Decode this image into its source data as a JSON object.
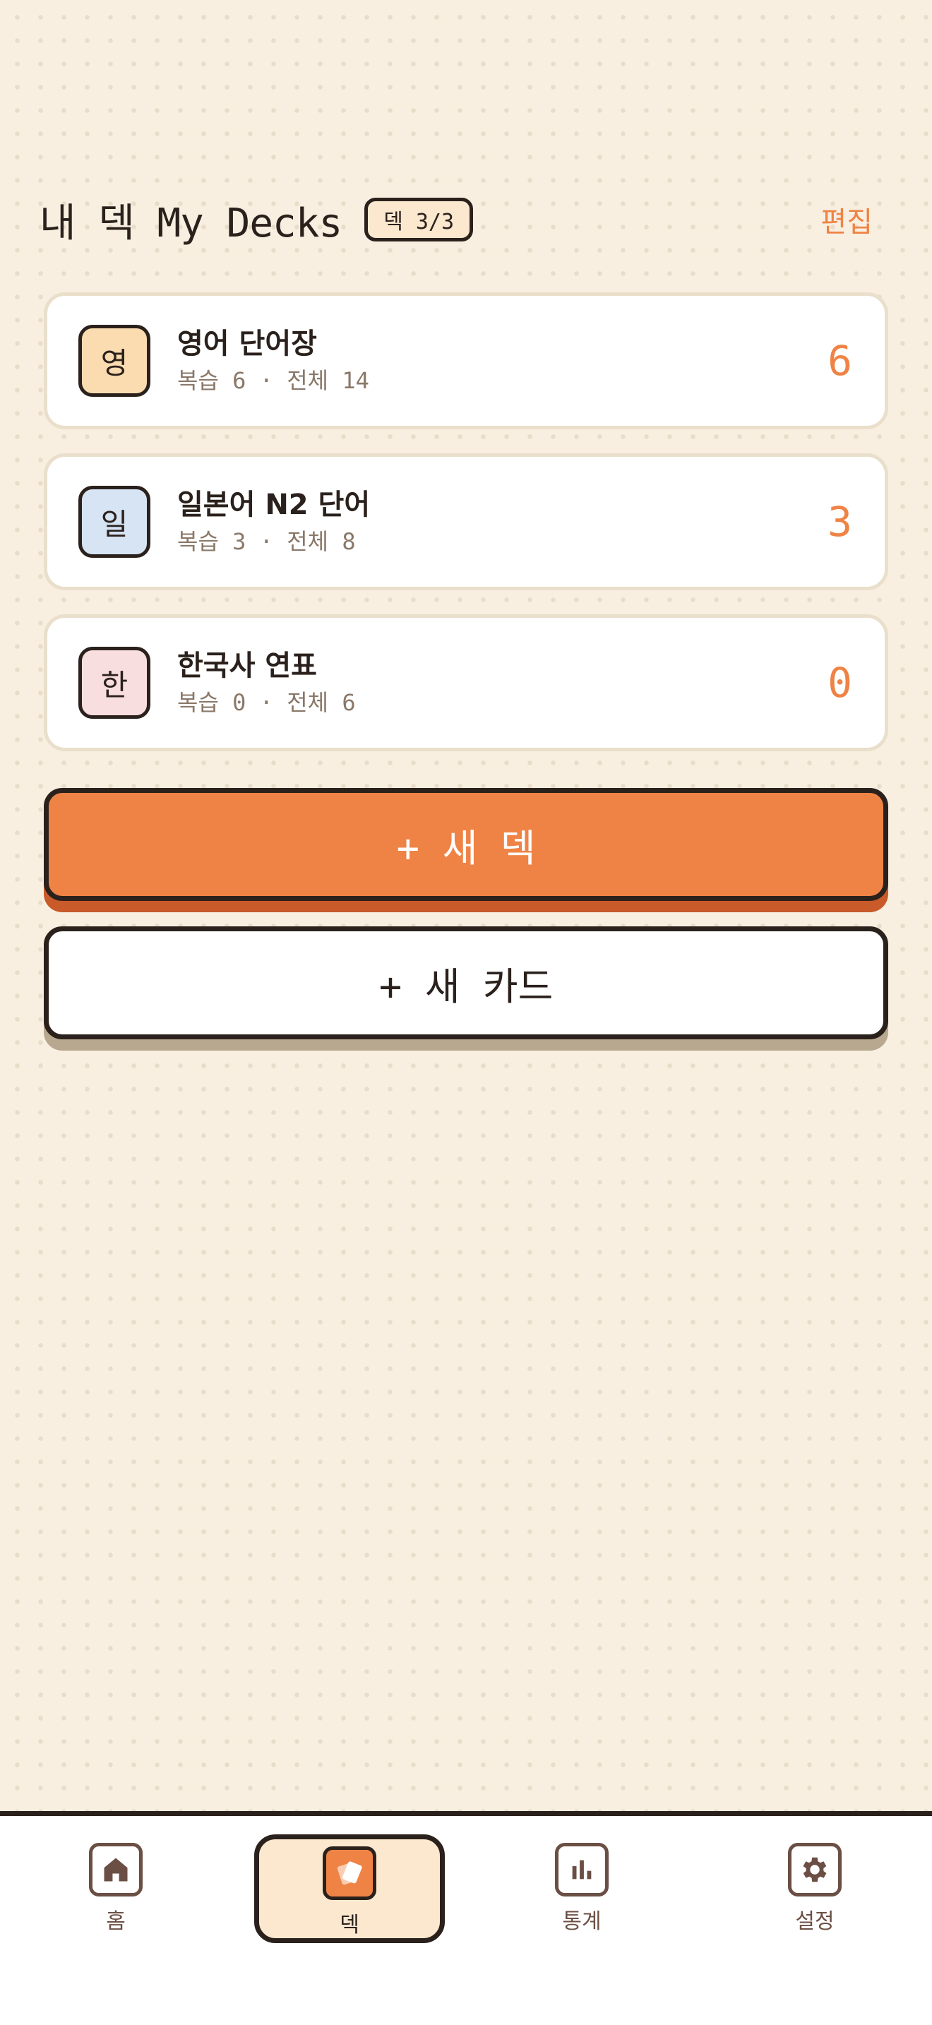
{
  "header": {
    "title": "내 덱 My Decks",
    "deck_badge": "덱 3/3",
    "edit_label": "편집"
  },
  "decks": [
    {
      "icon_char": "영",
      "name": "영어 단어장",
      "meta": "복습 6 · 전체 14",
      "due_count": "6",
      "icon_color": "#fbdcb0"
    },
    {
      "icon_char": "일",
      "name": "일본어 N2 단어",
      "meta": "복습 3 · 전체 8",
      "due_count": "3",
      "icon_color": "#d6e4f4"
    },
    {
      "icon_char": "한",
      "name": "한국사 연표",
      "meta": "복습 0 · 전체 6",
      "due_count": "0",
      "icon_color": "#f8dede"
    }
  ],
  "buttons": {
    "new_deck": "+ 새 덱",
    "new_card": "+ 새 카드"
  },
  "nav": {
    "items": [
      {
        "label": "홈",
        "icon": "home-icon"
      },
      {
        "label": "덱",
        "icon": "cards-icon",
        "active": true
      },
      {
        "label": "통계",
        "icon": "bar-chart-icon"
      },
      {
        "label": "설정",
        "icon": "gear-icon"
      }
    ]
  },
  "colors": {
    "accent": "#ef8345",
    "background": "#f8efe1",
    "ink": "#2b211c"
  }
}
